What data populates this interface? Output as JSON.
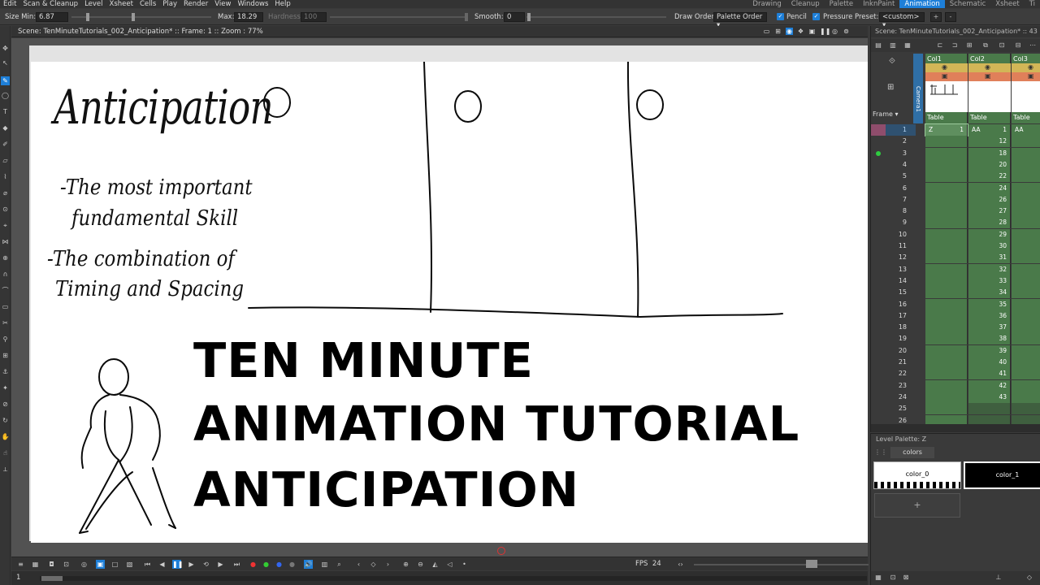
{
  "menu": [
    "Edit",
    "Scan & Cleanup",
    "Level",
    "Xsheet",
    "Cells",
    "Play",
    "Render",
    "View",
    "Windows",
    "Help"
  ],
  "rooms": [
    "Drawing",
    "Cleanup",
    "Palette",
    "InknPaint",
    "Animation",
    "Schematic",
    "Xsheet",
    "Ti"
  ],
  "active_room": "Animation",
  "tool_options": {
    "size_min_label": "Size Min:",
    "size_min_value": "6.87",
    "max_label": "Max:",
    "max_value": "18.29",
    "hardness_label": "Hardness:",
    "hardness_value": "100",
    "smooth_label": "Smooth:",
    "smooth_value": "0",
    "draw_order_label": "Draw Order:",
    "draw_order_value": "Palette Order",
    "pencil_label": "Pencil",
    "pressure_label": "Pressure",
    "preset_label": "Preset:",
    "preset_value": "<custom>",
    "add_label": "+",
    "remove_label": "-"
  },
  "viewer": {
    "title": "Scene: TenMinuteTutorials_002_Anticipation*  ::  Frame: 1  ::  Zoom : 77%"
  },
  "canvas": {
    "handwritten_title": "Anticipation",
    "note1_line1": "-The most important",
    "note1_line2": "fundamental Skill",
    "note2_line1": "-The combination of",
    "note2_line2": "Timing and Spacing",
    "title_line1": "TEN MINUTE",
    "title_line2": "ANIMATION TUTORIAL",
    "title_line3": "ANTICIPATION"
  },
  "playback": {
    "fps_label": "FPS",
    "fps_value": "24",
    "current_frame": "1"
  },
  "xsheet": {
    "header": "Scene: TenMinuteTutorials_002_Anticipation*  ::  43 Fr",
    "frame_label": "Frame",
    "camera_label": "Camera1",
    "columns": [
      {
        "name": "Col1",
        "pegbar": "Table"
      },
      {
        "name": "Col2",
        "pegbar": "Table"
      },
      {
        "name": "Col3",
        "pegbar": "Table"
      }
    ],
    "rows": [
      "1",
      "2",
      "3",
      "4",
      "5",
      "6",
      "7",
      "8",
      "9",
      "10",
      "11",
      "12",
      "13",
      "14",
      "15",
      "16",
      "17",
      "18",
      "19",
      "20",
      "21",
      "22",
      "23",
      "24",
      "25",
      "26"
    ],
    "col1_cells": {
      "level": "Z",
      "frame": "1"
    },
    "col2_level": "AA",
    "col2_frames": [
      "1",
      "12",
      "18",
      "20",
      "22",
      "24",
      "26",
      "27",
      "28",
      "29",
      "30",
      "31",
      "32",
      "33",
      "34",
      "35",
      "36",
      "37",
      "38",
      "39",
      "40",
      "41",
      "42",
      "43"
    ],
    "col3_level": "AA"
  },
  "level_palette": {
    "title": "Level Palette: Z",
    "page_tab": "colors",
    "styles": [
      {
        "name": "color_0",
        "color": "#ffffff"
      },
      {
        "name": "color_1",
        "color": "#000000"
      }
    ],
    "add_label": "+"
  },
  "colors": {
    "accent": "#1e7fd8",
    "xsheet_cell": "#4a7a4a",
    "preview_toggle": "#d2b657",
    "camstand_toggle": "#e0805a"
  }
}
